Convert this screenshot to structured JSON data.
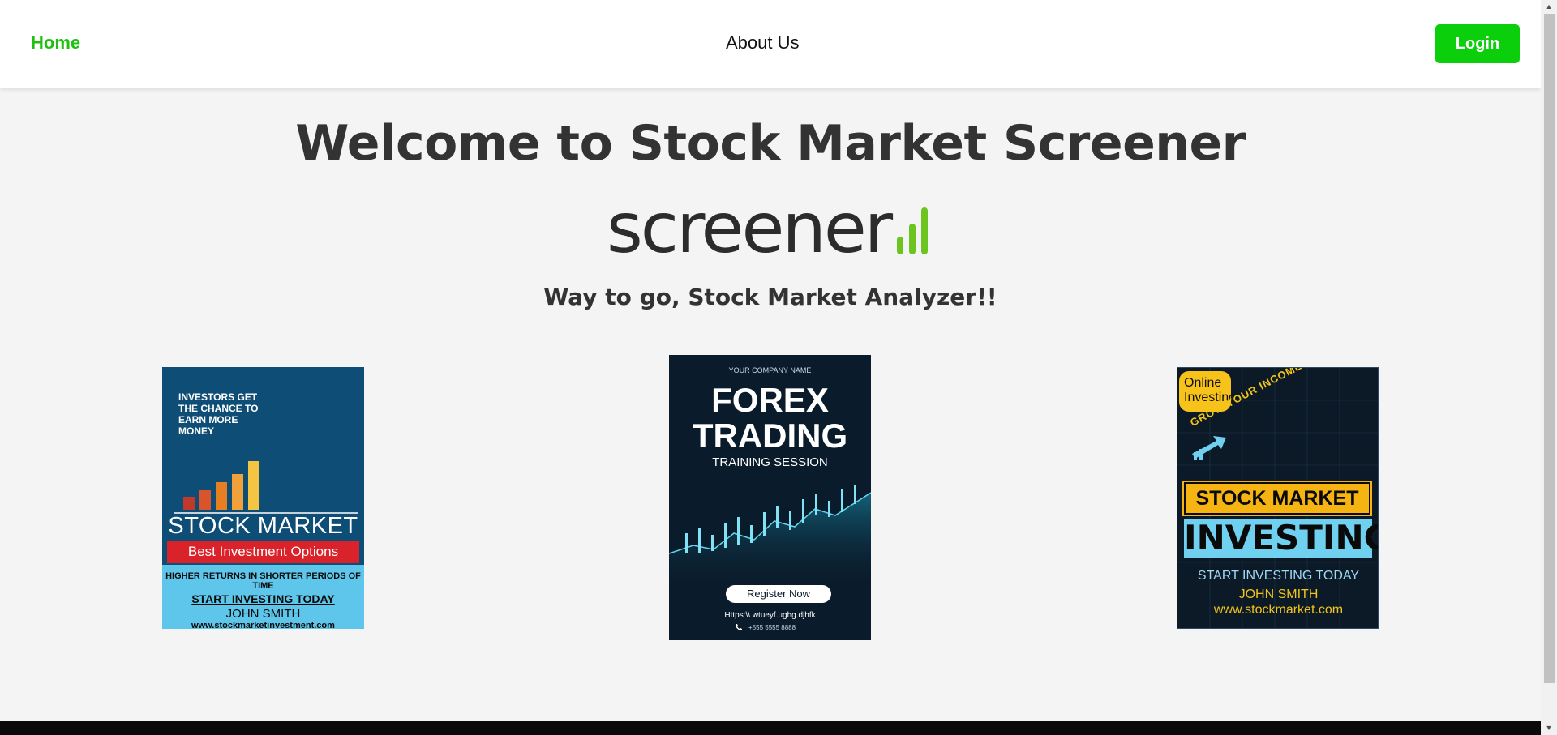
{
  "nav": {
    "home_label": "Home",
    "about_label": "About Us",
    "login_label": "Login"
  },
  "hero": {
    "title": "Welcome to Stock Market Screener",
    "logo_text": "screener",
    "tagline": "Way to go, Stock Market Analyzer!!"
  },
  "posters": [
    {
      "top_text": [
        "INVESTORS GET",
        "THE  CHANCE TO",
        "EARN MORE",
        "MONEY"
      ],
      "title": "STOCK MARKET",
      "banner": "Best Investment Options",
      "line1": "HIGHER RETURNS IN SHORTER PERIODS OF TIME",
      "line2": "START INVESTING TODAY",
      "line3": "JOHN SMITH",
      "line4": "www.stockmarketinvestment.com"
    },
    {
      "company": "YOUR COMPANY NAME",
      "title": "FOREX TRADING",
      "subtitle": "TRAINING SESSION",
      "button": "Register Now",
      "url": "Https:\\\\ wtueyf.ughg.djhfk",
      "phone": "+555 5555 8888"
    },
    {
      "badge": "Online Investing",
      "slogan": "GROW YOUR INCOME",
      "title": "STOCK MARKET",
      "subtitle": "INVESTING",
      "line1": "START INVESTING TODAY",
      "line2": "JOHN SMITH",
      "line3": "www.stockmarket.com"
    }
  ],
  "colors": {
    "accent_green": "#0ccf0c",
    "home_link": "#1fc00f",
    "heading": "#333333",
    "page_bg": "#f4f4f4"
  },
  "icons": [
    "phone-icon",
    "scroll-up-icon",
    "scroll-down-icon"
  ]
}
